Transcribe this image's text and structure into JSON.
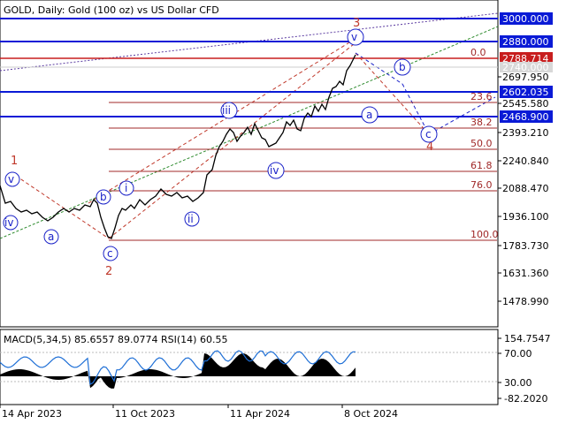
{
  "header": {
    "title": "GOLD, Daily:  Gold (100 oz) vs US Dollar CFD"
  },
  "indicator": {
    "label": "MACD(5,34,5) 85.6557 89.0774 RSI(14) 60.55"
  },
  "colors": {
    "price": "#000000",
    "level_line": "#0a1ad6",
    "current_price": "#c81e1e",
    "fib": "#a02828",
    "wave_red": "#c0392b",
    "wave_blue": "#1a22c8",
    "channel_green": "#2e8b2e",
    "channel_purple": "#5a3aa0"
  },
  "price_axis": {
    "ticks": [
      "2697.950",
      "2545.580",
      "2393.210",
      "2240.840",
      "2088.470",
      "1936.100",
      "1783.730",
      "1631.360",
      "1478.990"
    ],
    "tagged_levels": [
      {
        "label": "3000.000",
        "kind": "level"
      },
      {
        "label": "2880.000",
        "kind": "level"
      },
      {
        "label": "2788.714",
        "kind": "current"
      },
      {
        "label": "2740.000",
        "kind": "faded"
      },
      {
        "label": "2602.035",
        "kind": "level"
      },
      {
        "label": "2468.900",
        "kind": "level"
      }
    ]
  },
  "indicator_axis": {
    "ticks": [
      "154.7547",
      "70.00",
      "30.00",
      "-82.2020"
    ]
  },
  "time_axis": {
    "labels": [
      "14 Apr 2023",
      "11 Oct 2023",
      "11 Apr 2024",
      "8 Oct 2024"
    ]
  },
  "fibonacci": {
    "levels": [
      "0.0",
      "23.6",
      "38.2",
      "50.0",
      "61.8",
      "76.0",
      "100.0"
    ]
  },
  "waves": {
    "red": [
      "1",
      "2",
      "3",
      "4"
    ],
    "blue": [
      "i",
      "ii",
      "iii",
      "iv",
      "v",
      "a",
      "b",
      "c",
      "a",
      "b",
      "c",
      "iv",
      "v"
    ]
  }
}
